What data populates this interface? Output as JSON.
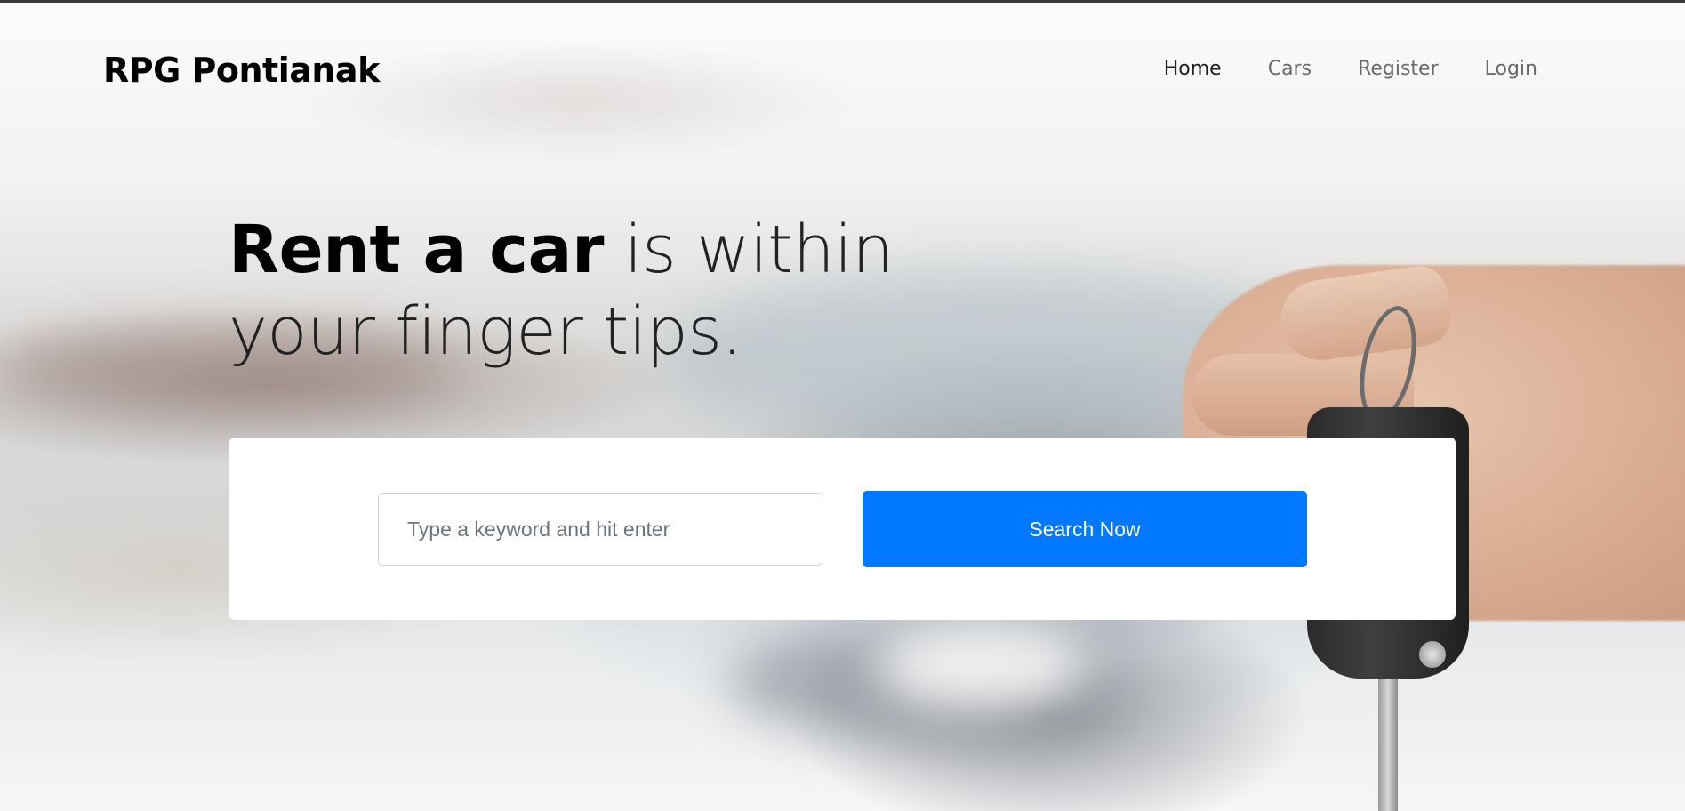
{
  "brand": "RPG Pontianak",
  "nav": {
    "items": [
      {
        "label": "Home",
        "active": true
      },
      {
        "label": "Cars",
        "active": false
      },
      {
        "label": "Register",
        "active": false
      },
      {
        "label": "Login",
        "active": false
      }
    ]
  },
  "hero": {
    "title_bold": "Rent a car",
    "title_rest_line1": " is within",
    "title_line2": "your finger tips."
  },
  "search": {
    "placeholder": "Type a keyword and hit enter",
    "value": "",
    "button_label": "Search Now"
  },
  "colors": {
    "accent": "#0078ff",
    "brand_text": "#000000",
    "nav_text": "#6a6a6a",
    "nav_active": "#222222"
  }
}
